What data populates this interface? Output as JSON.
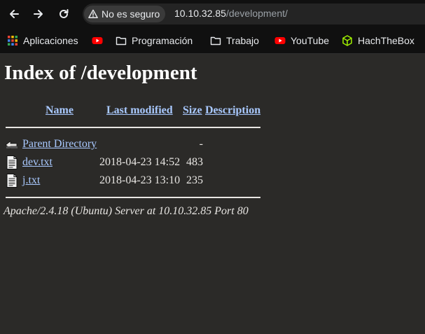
{
  "browser": {
    "security_label": "No es seguro",
    "url_host": "10.10.32.85",
    "url_path": "/development/"
  },
  "bookmarks": [
    {
      "label": "Aplicaciones",
      "icon": "apps-grid-icon"
    },
    {
      "label": "",
      "icon": "youtube-icon"
    },
    {
      "label": "Programación",
      "icon": "folder-icon"
    },
    {
      "label": "Trabajo",
      "icon": "folder-icon"
    },
    {
      "label": "YouTube",
      "icon": "youtube-icon"
    },
    {
      "label": "HachTheBox",
      "icon": "hackthebox-cube-icon"
    }
  ],
  "page": {
    "title": "Index of /development",
    "columns": {
      "name": "Name",
      "last_modified": "Last modified",
      "size": "Size",
      "description": "Description"
    },
    "entries": [
      {
        "name": "Parent Directory",
        "modified": "",
        "size": "-",
        "description": "",
        "icon": "back-arrow-icon"
      },
      {
        "name": "dev.txt",
        "modified": "2018-04-23 14:52",
        "size": "483",
        "description": "",
        "icon": "text-file-icon"
      },
      {
        "name": "j.txt",
        "modified": "2018-04-23 13:10",
        "size": "235",
        "description": "",
        "icon": "text-file-icon"
      }
    ],
    "footer": "Apache/2.4.18 (Ubuntu) Server at 10.10.32.85 Port 80"
  },
  "colors": {
    "link": "#a9c9ff",
    "background": "#2b2a28",
    "browser_chrome": "#101010"
  }
}
